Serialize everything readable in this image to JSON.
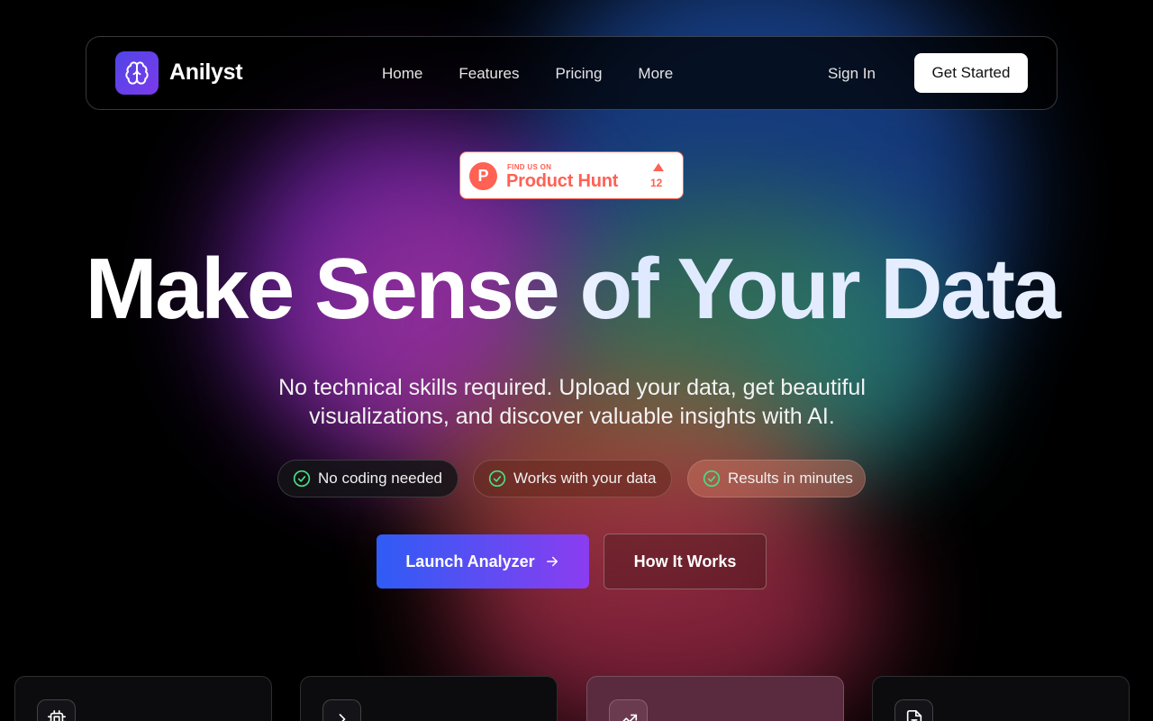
{
  "nav": {
    "brand": "Anilyst",
    "logo_icon": "brain-icon",
    "links": [
      "Home",
      "Features",
      "Pricing",
      "More"
    ],
    "sign_in": "Sign In",
    "cta": "Get Started"
  },
  "product_hunt": {
    "small_text": "FIND US ON",
    "big_text": "Product Hunt",
    "letter": "P",
    "upvotes": "12",
    "color": "#ff6154"
  },
  "hero": {
    "headline": "Make Sense of Your Data",
    "subtitle_line1": "No technical skills required. Upload your data, get beautiful",
    "subtitle_line2": "visualizations, and discover valuable insights with AI.",
    "features": [
      "No coding needed",
      "Works with your data",
      "Results in minutes"
    ],
    "primary_cta": "Launch Analyzer",
    "secondary_cta": "How It Works"
  },
  "cards": [
    {
      "icon": "cpu-icon"
    },
    {
      "icon": "chevron-right-icon"
    },
    {
      "icon": "trending-up-icon"
    },
    {
      "icon": "file-text-icon"
    }
  ],
  "colors": {
    "accent_blue": "#2f5cf5",
    "accent_purple": "#8b3df0",
    "check_green": "#4ade80"
  }
}
